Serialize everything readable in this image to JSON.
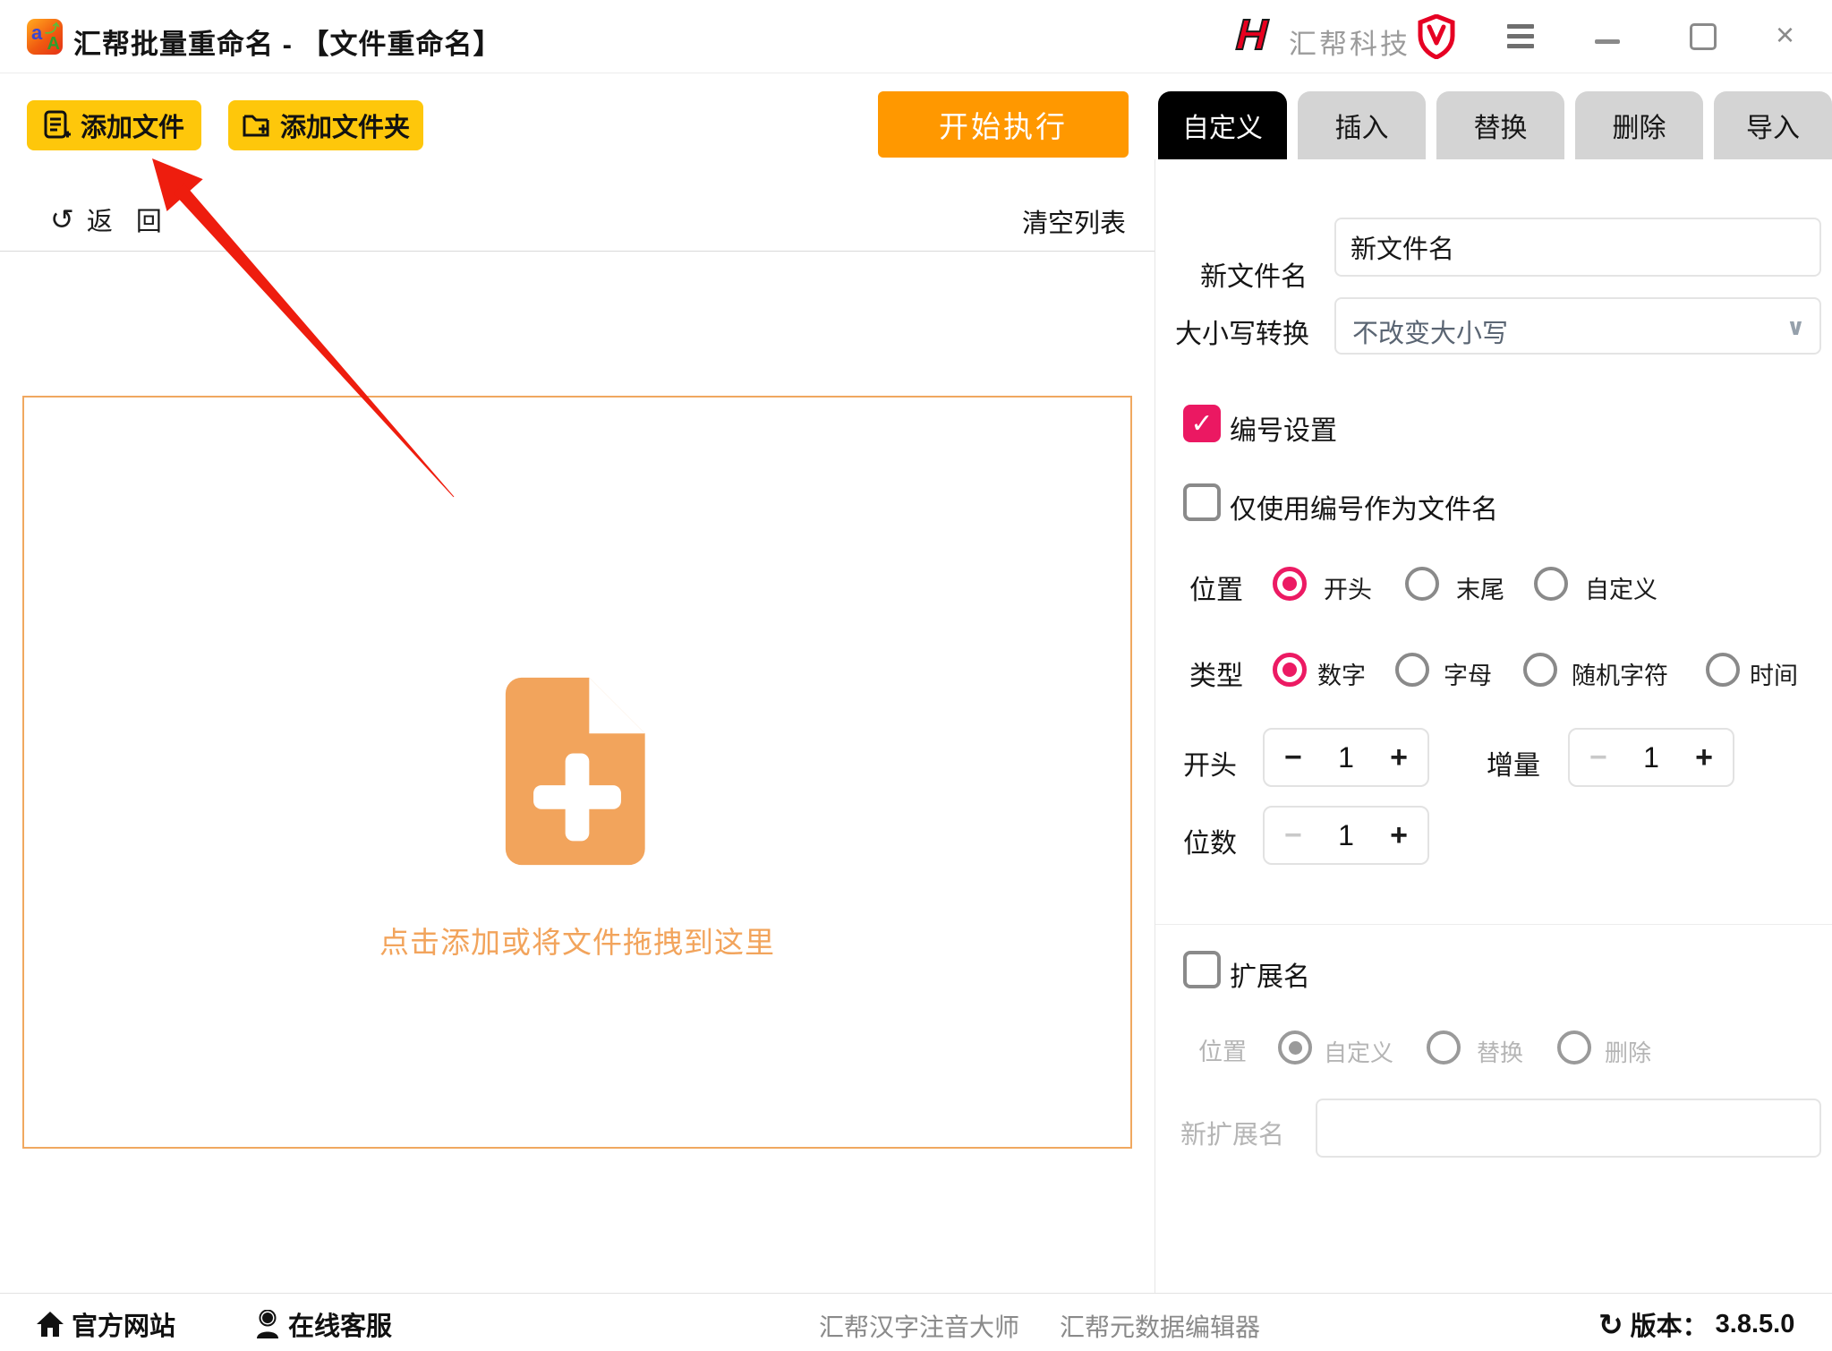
{
  "title_bar": {
    "app_title": "汇帮批量重命名 - 【文件重命名】",
    "brand": "汇帮科技",
    "brand_logo_letter": "H"
  },
  "icons": {
    "minus": "−",
    "plus": "+",
    "check": "✓",
    "chevron_down": "∨",
    "back_arrow": "↺",
    "refresh": "↻",
    "close": "×"
  },
  "toolbar": {
    "add_files": "添加文件",
    "add_folder": "添加文件夹",
    "execute": "开始执行"
  },
  "list_header": {
    "back_1": "返",
    "back_2": "回",
    "clear_list": "清空列表"
  },
  "dropzone": {
    "hint": "点击添加或将文件拖拽到这里"
  },
  "tabs": [
    {
      "label": "自定义",
      "active": true
    },
    {
      "label": "插入",
      "active": false
    },
    {
      "label": "替换",
      "active": false
    },
    {
      "label": "删除",
      "active": false
    },
    {
      "label": "导入",
      "active": false
    }
  ],
  "panel": {
    "new_name": {
      "label": "新文件名",
      "value": "新文件名"
    },
    "case_convert": {
      "label": "大小写转换",
      "value": "不改变大小写"
    },
    "numbering": {
      "label": "编号设置",
      "checked": true
    },
    "only_number": {
      "label": "仅使用编号作为文件名",
      "checked": false
    },
    "position": {
      "label": "位置",
      "options": [
        "开头",
        "末尾",
        "自定义"
      ],
      "selected": "开头"
    },
    "type": {
      "label": "类型",
      "options": [
        "数字",
        "字母",
        "随机字符",
        "时间"
      ],
      "selected": "数字"
    },
    "start": {
      "label": "开头",
      "value": "1"
    },
    "increment": {
      "label": "增量",
      "value": "1"
    },
    "digits": {
      "label": "位数",
      "value": "1"
    },
    "extension": {
      "label": "扩展名",
      "checked": false,
      "position": {
        "label": "位置",
        "options": [
          "自定义",
          "替换",
          "删除"
        ],
        "selected": "自定义"
      },
      "new_ext": {
        "label": "新扩展名",
        "value": ""
      }
    }
  },
  "footer": {
    "official_site": "官方网站",
    "online_service": "在线客服",
    "links": [
      "汇帮汉字注音大师",
      "汇帮元数据编辑器"
    ],
    "version_label": "版本：",
    "version": "3.8.5.0"
  },
  "colors": {
    "accent_yellow": "#FEC70B",
    "accent_orange": "#FF9800",
    "accent_pink": "#EB1862",
    "drop_orange": "#F2A45C",
    "annotation_red": "#EE1D0E",
    "tab_gray": "#D4D4D4"
  }
}
